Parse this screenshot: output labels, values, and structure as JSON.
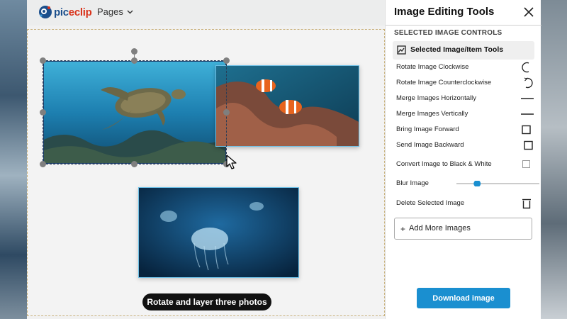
{
  "app": {
    "logo_text_a": "pic",
    "logo_text_b": "eclip",
    "pages_label": "Pages"
  },
  "canvas": {
    "caption": "Rotate and layer three photos",
    "photos": [
      "sea turtle",
      "clownfish",
      "jellyfish"
    ]
  },
  "panel": {
    "title": "Image Editing Tools",
    "section_label": "SELECTED IMAGE CONTROLS",
    "tools_tab_label": "Selected Image/Item Tools",
    "tools": [
      {
        "label": "Rotate Image Clockwise",
        "icon": "rotate-cw-icon"
      },
      {
        "label": "Rotate Image Counterclockwise",
        "icon": "rotate-ccw-icon"
      },
      {
        "label": "Merge Images Horizontally",
        "icon": "merge-horizontal-icon"
      },
      {
        "label": "Merge Images Vertically",
        "icon": "merge-vertical-icon"
      },
      {
        "label": "Bring Image Forward",
        "icon": "bring-forward-icon"
      },
      {
        "label": "Send Image Backward",
        "icon": "send-backward-icon"
      },
      {
        "label": "Convert Image to Black & White",
        "icon": "checkbox-icon"
      },
      {
        "label": "Blur Image",
        "icon": "slider"
      },
      {
        "label": "Delete Selected Image",
        "icon": "trash-icon"
      }
    ],
    "blur_value": 0.25,
    "add_more_label": "Add More Images",
    "add_more_icon": "+",
    "download_label": "Download image"
  },
  "colors": {
    "accent": "#1a8fd0",
    "selection": "#2a3c55",
    "handle": "#7f7f7f"
  }
}
